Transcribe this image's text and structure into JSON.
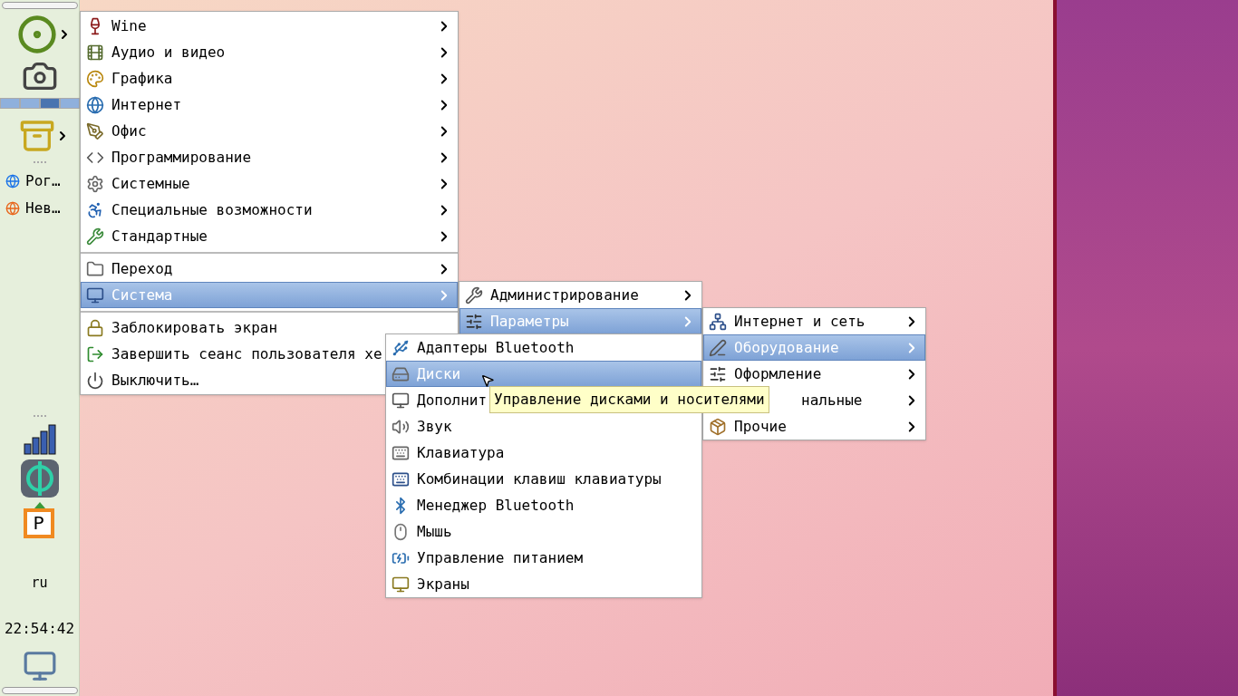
{
  "panel": {
    "pager": [
      {
        "selected": false
      },
      {
        "selected": false
      },
      {
        "selected": true
      },
      {
        "selected": false
      }
    ],
    "tasks": [
      {
        "label": "Рог…"
      },
      {
        "label": "Нев…"
      }
    ],
    "parking_label": "P",
    "keyboard_layout": "ru",
    "clock": "22:54:42"
  },
  "menu": {
    "sections": [
      [
        {
          "label": "Wine",
          "selected": false,
          "has_submenu": true
        },
        {
          "label": "Аудио и видео",
          "selected": false,
          "has_submenu": true
        },
        {
          "label": "Графика",
          "selected": false,
          "has_submenu": true
        },
        {
          "label": "Интернет",
          "selected": false,
          "has_submenu": true
        },
        {
          "label": "Офис",
          "selected": false,
          "has_submenu": true
        },
        {
          "label": "Программирование",
          "selected": false,
          "has_submenu": true
        },
        {
          "label": "Системные",
          "selected": false,
          "has_submenu": true
        },
        {
          "label": "Специальные возможности",
          "selected": false,
          "has_submenu": true
        },
        {
          "label": "Стандартные",
          "selected": false,
          "has_submenu": true
        }
      ],
      [
        {
          "label": "Переход",
          "selected": false,
          "has_submenu": true
        },
        {
          "label": "Система",
          "selected": true,
          "has_submenu": true,
          "children": [
            {
              "label": "Администрирование",
              "selected": false,
              "has_submenu": true
            },
            {
              "label": "Параметры",
              "selected": true,
              "has_submenu": true,
              "children": [
                {
                  "label": "Интернет и сеть",
                  "selected": false,
                  "has_submenu": true
                },
                {
                  "label": "Оборудование",
                  "selected": true,
                  "has_submenu": true,
                  "children": [
                    {
                      "label": "Адаптеры Bluetooth",
                      "selected": false,
                      "has_submenu": false
                    },
                    {
                      "label": "Диски",
                      "selected": true,
                      "has_submenu": false
                    },
                    {
                      "label": "Дополнит",
                      "selected": false
                    },
                    {
                      "label": "Звук",
                      "selected": false,
                      "has_submenu": false
                    },
                    {
                      "label": "Клавиатура",
                      "selected": false,
                      "has_submenu": false
                    },
                    {
                      "label": "Комбинации клавиш клавиатуры",
                      "selected": false,
                      "has_submenu": false
                    },
                    {
                      "label": "Менеджер Bluetooth",
                      "selected": false,
                      "has_submenu": false
                    },
                    {
                      "label": "Мышь",
                      "selected": false,
                      "has_submenu": false
                    },
                    {
                      "label": "Управление питанием",
                      "selected": false,
                      "has_submenu": false
                    },
                    {
                      "label": "Экраны",
                      "selected": false,
                      "has_submenu": false
                    }
                  ]
                },
                {
                  "label": "Оформление",
                  "selected": false,
                  "has_submenu": true
                },
                {
                  "label": "нальные",
                  "selected": false,
                  "has_submenu": true,
                  "start_hidden": true
                },
                {
                  "label": "Прочие",
                  "selected": false,
                  "has_submenu": true
                }
              ]
            }
          ]
        }
      ],
      [
        {
          "label": "Заблокировать экран",
          "selected": false,
          "has_submenu": false
        },
        {
          "label": "Завершить сеанс пользователя хе",
          "selected": false
        },
        {
          "label": "Выключить…",
          "selected": false
        }
      ]
    ]
  },
  "tooltip": "Управление дисками и носителями"
}
